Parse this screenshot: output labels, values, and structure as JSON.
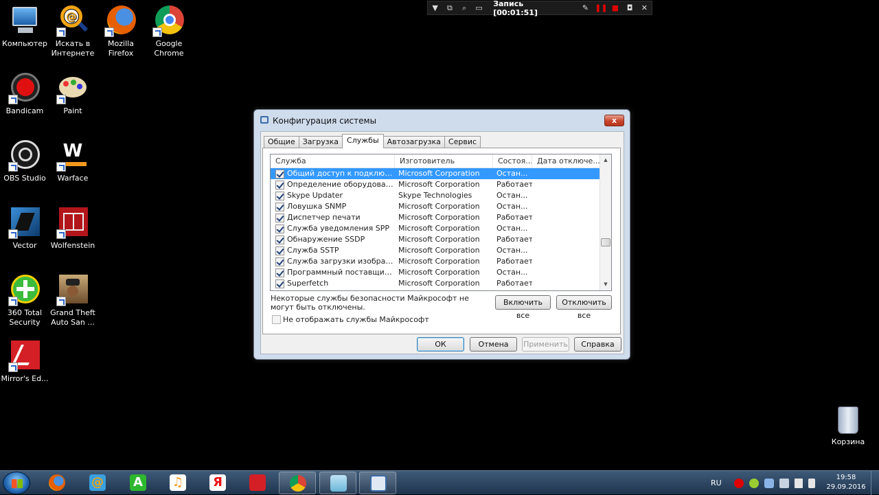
{
  "recorder": {
    "title": "Запись [00:01:51]"
  },
  "desktop_icons": [
    {
      "label": "Компьютер"
    },
    {
      "label": "Искать в Интернете"
    },
    {
      "label": "Mozilla Firefox"
    },
    {
      "label": "Google Chrome"
    },
    {
      "label": "Bandicam"
    },
    {
      "label": "Paint"
    },
    {
      "label": "OBS Studio"
    },
    {
      "label": "Warface"
    },
    {
      "label": "Vector"
    },
    {
      "label": "Wolfenstein"
    },
    {
      "label": "360 Total Security"
    },
    {
      "label": "Grand Theft Auto San ..."
    },
    {
      "label": "Mirror's Ed..."
    }
  ],
  "recycle_bin": {
    "label": "Корзина"
  },
  "dialog": {
    "title": "Конфигурация системы",
    "close": "x",
    "tabs": [
      {
        "label": "Общие"
      },
      {
        "label": "Загрузка"
      },
      {
        "label": "Службы",
        "active": true
      },
      {
        "label": "Автозагрузка"
      },
      {
        "label": "Сервис"
      }
    ],
    "columns": [
      "Служба",
      "Изготовитель",
      "Состоя...",
      "Дата отключе..."
    ],
    "rows": [
      {
        "name": "Общий доступ к подключени...",
        "maker": "Microsoft Corporation",
        "status": "Остан...",
        "date": "",
        "selected": true
      },
      {
        "name": "Определение оборудования о...",
        "maker": "Microsoft Corporation",
        "status": "Работает",
        "date": ""
      },
      {
        "name": "Skype Updater",
        "maker": "Skype Technologies",
        "status": "Остан...",
        "date": ""
      },
      {
        "name": "Ловушка SNMP",
        "maker": "Microsoft Corporation",
        "status": "Остан...",
        "date": ""
      },
      {
        "name": "Диспетчер печати",
        "maker": "Microsoft Corporation",
        "status": "Работает",
        "date": ""
      },
      {
        "name": "Служба уведомления SPP",
        "maker": "Microsoft Corporation",
        "status": "Остан...",
        "date": ""
      },
      {
        "name": "Обнаружение SSDP",
        "maker": "Microsoft Corporation",
        "status": "Работает",
        "date": ""
      },
      {
        "name": "Служба SSTP",
        "maker": "Microsoft Corporation",
        "status": "Остан...",
        "date": ""
      },
      {
        "name": "Служба загрузки изображени...",
        "maker": "Microsoft Corporation",
        "status": "Работает",
        "date": ""
      },
      {
        "name": "Программный поставщик тене...",
        "maker": "Microsoft Corporation",
        "status": "Остан...",
        "date": ""
      },
      {
        "name": "Superfetch",
        "maker": "Microsoft Corporation",
        "status": "Работает",
        "date": ""
      }
    ],
    "note": "Некоторые службы безопасности Майкрософт не могут быть отключены.",
    "enable_all": "Включить все",
    "disable_all": "Отключить все",
    "hide_ms": "Не отображать службы Майкрософт",
    "ok": "ОК",
    "cancel": "Отмена",
    "apply": "Применить",
    "help": "Справка"
  },
  "taskbar": {
    "lang": "RU",
    "time": "19:58",
    "date": "29.09.2016"
  },
  "colors": {
    "selection": "#3399ff",
    "desktop": "#000000",
    "taskbar": "#2b4563"
  }
}
